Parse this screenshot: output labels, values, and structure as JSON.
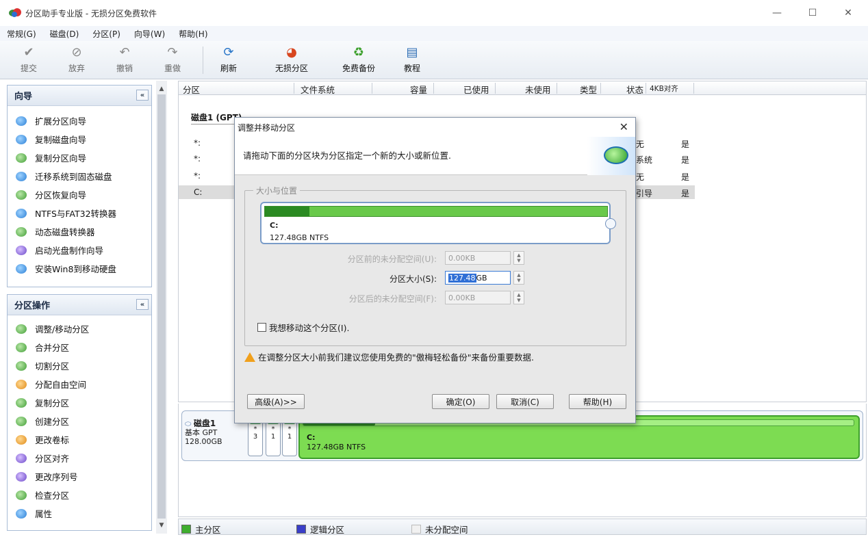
{
  "window": {
    "title": "分区助手专业版 - 无损分区免费软件",
    "min": "—",
    "max": "☐",
    "close": "✕"
  },
  "menu": [
    "常规(G)",
    "磁盘(D)",
    "分区(P)",
    "向导(W)",
    "帮助(H)"
  ],
  "toolbar": {
    "submit": "提交",
    "discard": "放弃",
    "undo": "撤销",
    "redo": "重做",
    "refresh": "刷新",
    "lossless": "无损分区",
    "backup": "免费备份",
    "tutorial": "教程"
  },
  "wizard_panel": {
    "title": "向导",
    "collapse": "«",
    "items": [
      "扩展分区向导",
      "复制磁盘向导",
      "复制分区向导",
      "迁移系统到固态磁盘",
      "分区恢复向导",
      "NTFS与FAT32转换器",
      "动态磁盘转换器",
      "启动光盘制作向导",
      "安装Win8到移动硬盘"
    ]
  },
  "ops_panel": {
    "title": "分区操作",
    "collapse": "«",
    "items": [
      "调整/移动分区",
      "合并分区",
      "切割分区",
      "分配自由空间",
      "复制分区",
      "创建分区",
      "更改卷标",
      "分区对齐",
      "更改序列号",
      "检查分区",
      "属性"
    ]
  },
  "grid": {
    "headers": [
      "分区",
      "文件系统",
      "容量",
      "已使用",
      "未使用",
      "类型",
      "状态",
      "4KB对齐"
    ],
    "disk_label": "磁盘1 (GPT)",
    "rows": [
      {
        "name": "*:",
        "state": "无",
        "align": "是"
      },
      {
        "name": "*:",
        "state": "系统",
        "align": "是"
      },
      {
        "name": "*:",
        "state": "无",
        "align": "是"
      },
      {
        "name": "C:",
        "state": "引导",
        "align": "是"
      }
    ]
  },
  "diskmap": {
    "name": "磁盘1",
    "type": "基本 GPT",
    "size": "128.00GB",
    "small_parts": [
      {
        "star": "*",
        "num": "3"
      },
      {
        "star": "*",
        "num": "1"
      },
      {
        "star": "*",
        "num": "1"
      }
    ],
    "main_part": {
      "name": "C:",
      "info": "127.48GB NTFS",
      "used_fraction": 0.13
    }
  },
  "legend": {
    "primary": "主分区",
    "logical": "逻辑分区",
    "unallocated": "未分配空间",
    "colors": {
      "primary": "#3fae2f",
      "logical": "#3a3fc8",
      "unallocated": "#f1f1f1"
    }
  },
  "dialog": {
    "title": "调整并移动分区",
    "close": "✕",
    "message": "请拖动下面的分区块为分区指定一个新的大小或新位置.",
    "group_label": "大小与位置",
    "partition": {
      "name": "C:",
      "info": "127.48GB NTFS",
      "used_fraction": 0.13
    },
    "before_label": "分区前的未分配空间(U):",
    "before_value": "0.00KB",
    "size_label": "分区大小(S):",
    "size_selected": "127.48",
    "size_unit": "GB",
    "after_label": "分区后的未分配空间(F):",
    "after_value": "0.00KB",
    "move_checkbox": "我想移动这个分区(I).",
    "warning": "在调整分区大小前我们建议您使用免费的\"傲梅轻松备份\"来备份重要数据.",
    "btn_advanced": "高级(A)>>",
    "btn_ok": "确定(O)",
    "btn_cancel": "取消(C)",
    "btn_help": "帮助(H)"
  }
}
